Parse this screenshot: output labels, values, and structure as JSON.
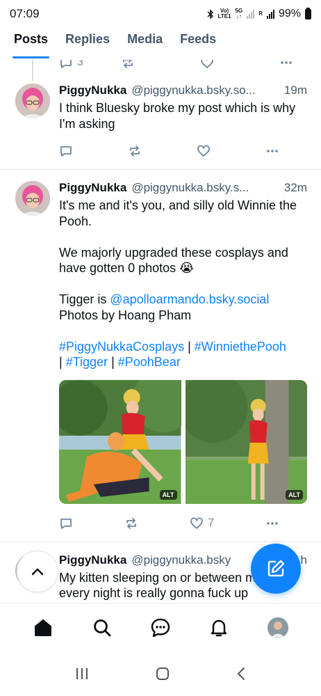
{
  "status_bar": {
    "time": "07:09",
    "network_label_top": "Vo)",
    "network_label_bottom": "LTE1",
    "network5g_top": "5G",
    "network5g_bottom": "↓↑",
    "signal_sim2": "R",
    "battery_percent": "99%"
  },
  "tabs": [
    {
      "label": "Posts",
      "active": true
    },
    {
      "label": "Replies",
      "active": false
    },
    {
      "label": "Media",
      "active": false
    },
    {
      "label": "Feeds",
      "active": false
    }
  ],
  "top_stub": {
    "reply_count": "3"
  },
  "posts": [
    {
      "author": "PiggyNukka",
      "handle": "@piggynukka.bsky.so...",
      "time": "19m",
      "text": "I think Bluesky broke my post which is why I'm asking",
      "like_count": ""
    },
    {
      "author": "PiggyNukka",
      "handle": "@piggynukka.bsky.s...",
      "time": "32m",
      "text_intro": "It's me and it's you, and silly old Winnie the Pooh.\n\nWe majorly upgraded these cosplays and have gotten 0 photos 😭\n\nTigger is ",
      "mention": "@apolloarmando.bsky.social",
      "text_after_mention": "\nPhotos by Hoang Pham\n\n",
      "hashtag1": "#PiggyNukkaCosplays",
      "sep1": " | ",
      "hashtag2": "#WinniethePooh",
      "sep2": "\n| ",
      "hashtag3": "#Tigger",
      "sep3": " | ",
      "hashtag4": "#PoohBear",
      "images": [
        {
          "alt_badge": "ALT"
        },
        {
          "alt_badge": "ALT"
        }
      ],
      "like_count": "7"
    },
    {
      "author": "PiggyNukka",
      "handle": "@piggynukka.bsky",
      "time": "1h",
      "text": "My kitten sleeping on or between my legs every night is really gonna fuck up"
    }
  ],
  "icons": {
    "reply": "reply-icon",
    "repost": "repost-icon",
    "like": "heart-icon",
    "more": "more-icon",
    "home": "home-icon",
    "search": "search-icon",
    "chat": "chat-icon",
    "notifications": "bell-icon",
    "compose": "compose-icon",
    "scroll_top": "chevron-up-icon"
  },
  "colors": {
    "accent": "#1083fe",
    "muted": "#42576c",
    "action": "#6f869f"
  }
}
